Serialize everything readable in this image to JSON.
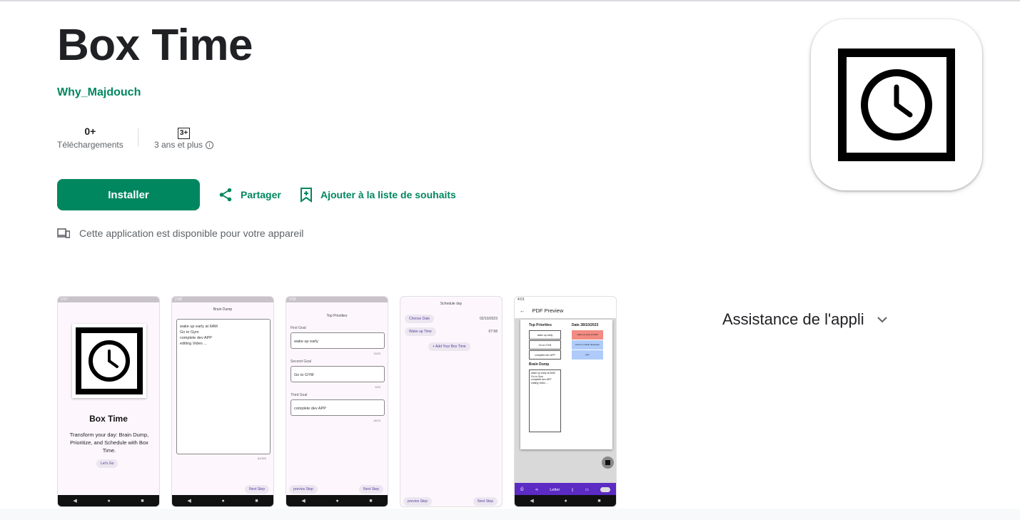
{
  "app": {
    "title": "Box Time",
    "developer": "Why_Majdouch",
    "downloads_value": "0+",
    "downloads_label": "Téléchargements",
    "rating_badge": "3+",
    "rating_label": "3 ans et plus",
    "install_label": "Installer",
    "share_label": "Partager",
    "wishlist_label": "Ajouter à la liste de souhaits",
    "availability_text": "Cette application est disponible pour votre appareil",
    "support_label": "Assistance de l'appli"
  },
  "icons": {
    "share": "share-icon",
    "wishlist": "bookmark-add-icon",
    "device": "devices-icon",
    "info": "info-icon",
    "expand": "chevron-down-icon",
    "app": "clock-icon"
  },
  "colors": {
    "accent": "#01875f",
    "text": "#202124",
    "muted": "#5f6368"
  },
  "screenshots": {
    "s1": {
      "status_time": "2:57",
      "title": "Box Time",
      "tagline": "Transform your day: Brain Dump, Prioritize, and Schedule with Box Time.",
      "button": "Let's Go"
    },
    "s2": {
      "status_time": "2:58",
      "header": "Brain Dump",
      "lines": [
        "wake up early at 6AM",
        "Go to Gym",
        "complete dev APP",
        "editing Video ..."
      ],
      "counter": "61/300",
      "next": "Next Step"
    },
    "s3": {
      "status_time": "2:59",
      "header": "Top Priorities",
      "goal1_label": "First Goal",
      "goal1_value": "wake up early",
      "goal1_count": "13/20",
      "goal2_label": "Second Goal",
      "goal2_value": "Go to GYM",
      "goal2_count": "9/20",
      "goal3_label": "Third Goal",
      "goal3_value": "complete dev APP",
      "goal3_count": "16/20",
      "prev": "previos Step",
      "next": "Next Step"
    },
    "s4": {
      "header": "Schedule day",
      "choose_date": "Choose Date",
      "date_value": "02/10/2023",
      "wake_time": "Wake up Time",
      "time_value": "07:58",
      "add_box": "+ Add Your Box Time",
      "prev": "previos Step",
      "next": "Next Step"
    },
    "s5": {
      "status_time": "4:01",
      "header": "PDF Preview",
      "priorities_title": "Top Priorities",
      "date_title": "Date 28/10/2023",
      "p1": "wake up early",
      "p2": "Go to GYM",
      "p3": "complete dev APP",
      "brain_title": "Brain Dump",
      "brain_lines": [
        "wake up early at 6AM",
        "Go to Gym",
        "complete dev APP",
        "editing Video ..."
      ],
      "sched1": "wake up early at 6AM",
      "sched2": "work on mobile developer",
      "sched3": "gym",
      "paper_label": "Letter"
    }
  }
}
